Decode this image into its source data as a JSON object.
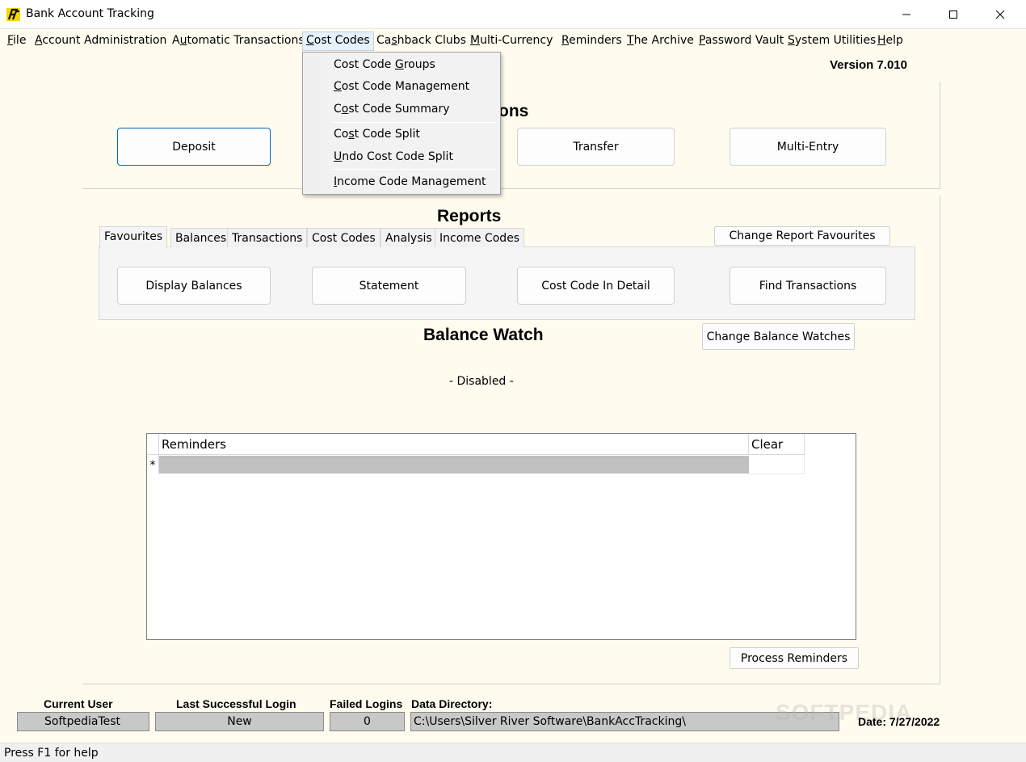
{
  "window": {
    "title": "Bank Account Tracking",
    "icon": "bank-logo-icon"
  },
  "menu": {
    "items": [
      {
        "pre": "",
        "acc": "F",
        "post": "ile"
      },
      {
        "pre": "",
        "acc": "A",
        "post": "ccount Administration"
      },
      {
        "pre": "A",
        "acc": "u",
        "post": "tomatic Transactions"
      },
      {
        "pre": "",
        "acc": "C",
        "post": "ost Codes"
      },
      {
        "pre": "Ca",
        "acc": "s",
        "post": "hback Clubs"
      },
      {
        "pre": "",
        "acc": "M",
        "post": "ulti-Currency"
      },
      {
        "pre": "",
        "acc": "R",
        "post": "eminders"
      },
      {
        "pre": "",
        "acc": "T",
        "post": "he Archive"
      },
      {
        "pre": "",
        "acc": "P",
        "post": "assword Vault"
      },
      {
        "pre": "",
        "acc": "S",
        "post": "ystem Utilities"
      },
      {
        "pre": "",
        "acc": "H",
        "post": "elp"
      }
    ],
    "active_index": 3
  },
  "cost_codes_menu": {
    "items": [
      {
        "pre": "Cost Code ",
        "acc": "G",
        "post": "roups"
      },
      {
        "pre": "",
        "acc": "C",
        "post": "ost Code Management"
      },
      {
        "pre": "C",
        "acc": "o",
        "post": "st Code Summary"
      },
      {
        "pre": "Co",
        "acc": "s",
        "post": "t Code Split"
      },
      {
        "pre": "",
        "acc": "U",
        "post": "ndo Cost Code Split"
      },
      {
        "pre": "",
        "acc": "I",
        "post": "ncome Code Management"
      }
    ]
  },
  "version": "Version 7.010",
  "transactions": {
    "title_visible": "ons",
    "buttons": {
      "deposit": "Deposit",
      "transfer": "Transfer",
      "multi_entry": "Multi-Entry"
    }
  },
  "reports": {
    "title": "Reports",
    "change_favourites": "Change Report Favourites",
    "tabs": [
      "Favourites",
      "Balances",
      "Transactions",
      "Cost Codes",
      "Analysis",
      "Income Codes"
    ],
    "active_tab": 0,
    "buttons": {
      "display_balances": "Display Balances",
      "statement": "Statement",
      "cost_code_in_detail": "Cost Code In Detail",
      "find_transactions": "Find Transactions"
    }
  },
  "balance_watch": {
    "title": "Balance Watch",
    "change_button": "Change Balance Watches",
    "status": "- Disabled -"
  },
  "reminders_grid": {
    "col_reminders": "Reminders",
    "col_clear": "Clear",
    "new_row_marker": "*",
    "process_button": "Process Reminders"
  },
  "footer": {
    "current_user_label": "Current User",
    "current_user": "SoftpediaTest",
    "last_login_label": "Last Successful Login",
    "last_login": "New",
    "failed_logins_label": "Failed Logins",
    "failed_logins": "0",
    "data_dir_label": "Data Directory:",
    "data_dir": "C:\\Users\\Silver River Software\\BankAccTracking\\",
    "date": "Date: 7/27/2022",
    "watermark": "SOFTPEDIA"
  },
  "status": {
    "text": "Press F1 for help"
  }
}
